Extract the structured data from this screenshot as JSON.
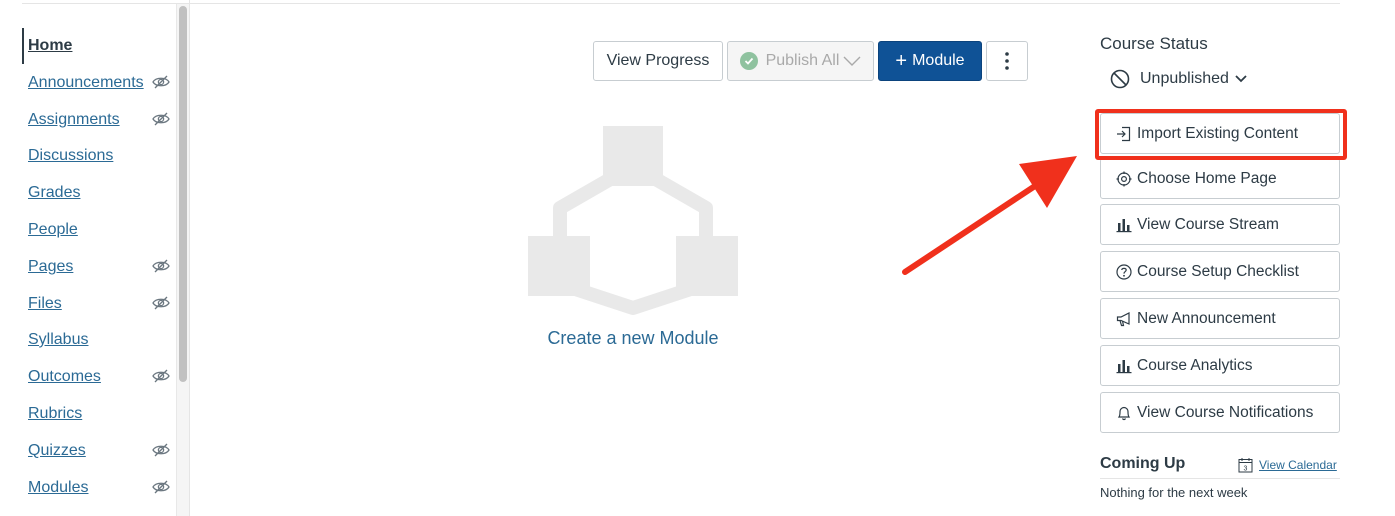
{
  "nav": {
    "items": [
      {
        "label": "Home",
        "active": true,
        "hidden": false
      },
      {
        "label": "Announcements",
        "active": false,
        "hidden": true
      },
      {
        "label": "Assignments",
        "active": false,
        "hidden": true
      },
      {
        "label": "Discussions",
        "active": false,
        "hidden": false
      },
      {
        "label": "Grades",
        "active": false,
        "hidden": false
      },
      {
        "label": "People",
        "active": false,
        "hidden": false
      },
      {
        "label": "Pages",
        "active": false,
        "hidden": true
      },
      {
        "label": "Files",
        "active": false,
        "hidden": true
      },
      {
        "label": "Syllabus",
        "active": false,
        "hidden": false
      },
      {
        "label": "Outcomes",
        "active": false,
        "hidden": true
      },
      {
        "label": "Rubrics",
        "active": false,
        "hidden": false
      },
      {
        "label": "Quizzes",
        "active": false,
        "hidden": true
      },
      {
        "label": "Modules",
        "active": false,
        "hidden": true
      }
    ]
  },
  "toolbar": {
    "view_progress": "View Progress",
    "publish_all": "Publish All",
    "add_module": "Module"
  },
  "main": {
    "create_module_link": "Create a new Module"
  },
  "sidebar": {
    "course_status_title": "Course Status",
    "status_value": "Unpublished",
    "buttons": [
      {
        "label": "Import Existing Content",
        "icon": "import-icon"
      },
      {
        "label": "Choose Home Page",
        "icon": "target-icon"
      },
      {
        "label": "View Course Stream",
        "icon": "bar-chart-icon"
      },
      {
        "label": "Course Setup Checklist",
        "icon": "question-circle-icon"
      },
      {
        "label": "New Announcement",
        "icon": "megaphone-icon"
      },
      {
        "label": "Course Analytics",
        "icon": "bar-chart-icon"
      },
      {
        "label": "View Course Notifications",
        "icon": "bell-icon"
      }
    ],
    "coming_up_title": "Coming Up",
    "calendar_icon_day": "3",
    "view_calendar": "View Calendar",
    "nothing_text": "Nothing for the next week"
  },
  "colors": {
    "link": "#2b6a95",
    "primary": "#0f5296",
    "annotation": "#f0301c",
    "publish_check": "#8fc29f"
  }
}
